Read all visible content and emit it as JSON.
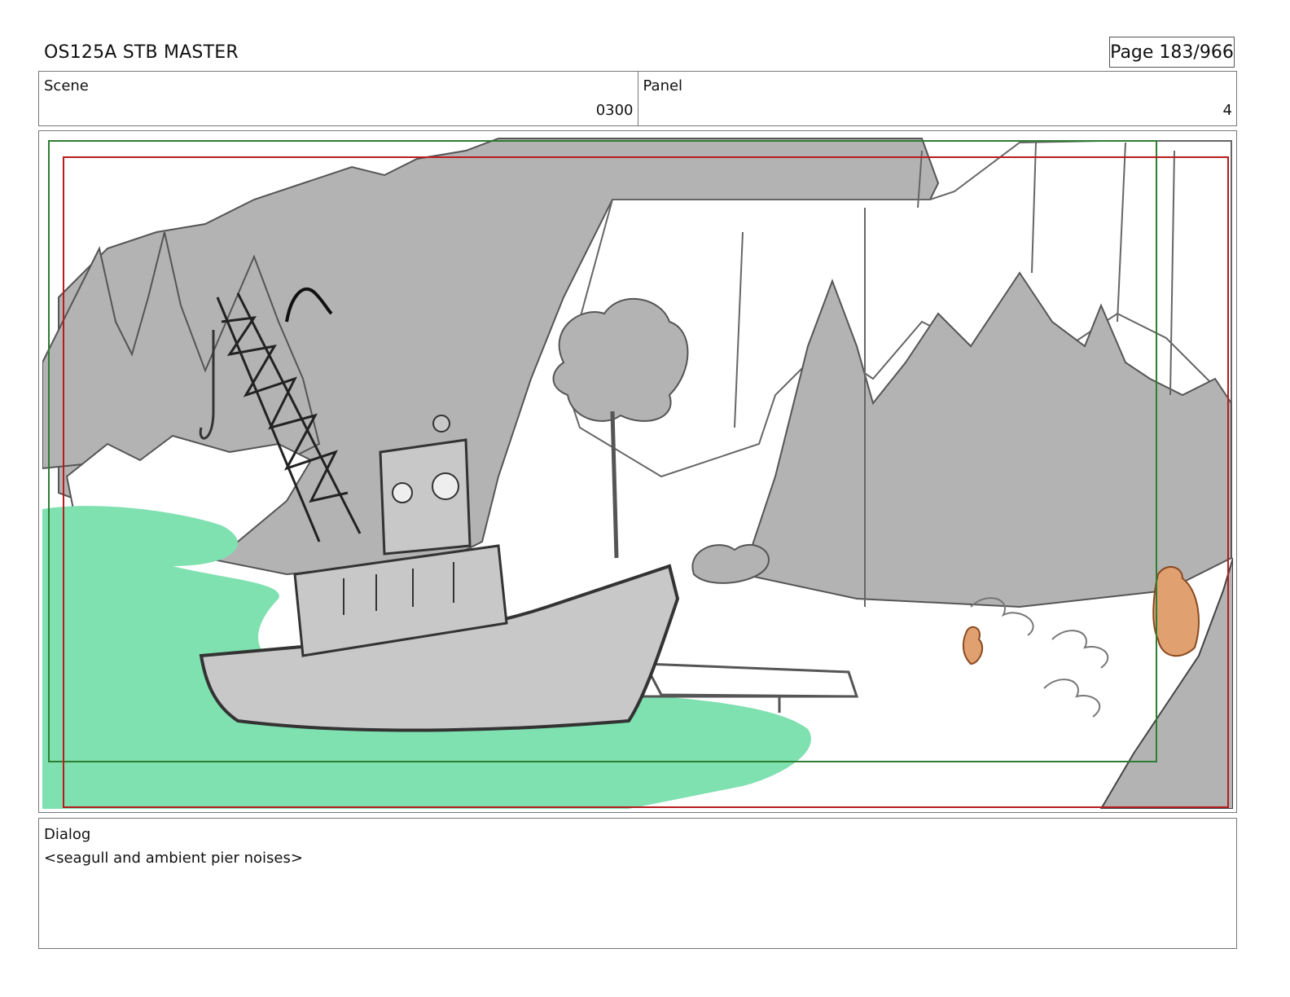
{
  "header": {
    "title": "OS125A STB MASTER",
    "page": "Page 183/966"
  },
  "info": {
    "scene_label": "Scene",
    "scene_value": "0300",
    "panel_label": "Panel",
    "panel_value": "4"
  },
  "panel": {
    "colors": {
      "water": "#7fe0b0",
      "foliage_gray": "#b3b3b3",
      "boat_gray": "#c8c8c8",
      "line": "#444444",
      "safe_frame_green": "#2e7d32",
      "action_frame_red": "#b71c1c",
      "character_orange": "#e0a070"
    }
  },
  "dialog": {
    "label": "Dialog",
    "text": "<seagull and ambient pier noises>"
  }
}
